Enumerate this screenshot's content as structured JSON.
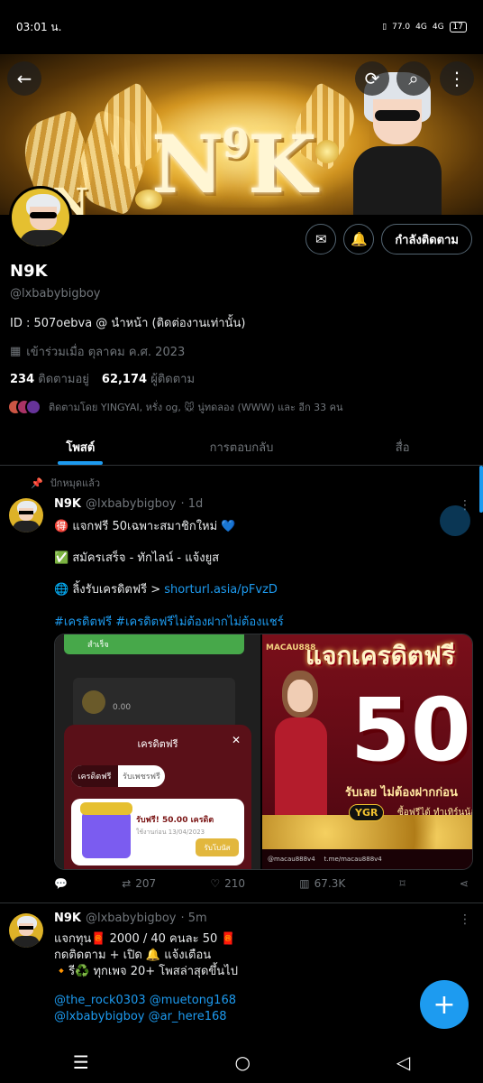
{
  "status_bar": {
    "time": "03:01 น.",
    "net_speed": "77.0",
    "signal1": "4G",
    "signal2": "4G",
    "battery": "17"
  },
  "banner": {
    "logo_main": "N",
    "logo_sup": "9",
    "logo_end": "K",
    "logo_small": "N"
  },
  "profile": {
    "name": "N9K",
    "handle": "@lxbabybigboy",
    "bio": "ID : 507oebva @ นำหน้า (ติดต่องานเท่านั้น)",
    "joined": "เข้าร่วมเมื่อ ตุลาคม ค.ศ. 2023",
    "following_count": "234",
    "following_label": "ติดตามอยู่",
    "followers_count": "62,174",
    "followers_label": "ผู้ติดตาม",
    "followed_by": "ติดตามโดย YINGYAI, หรั่ง og, 🐭 นู่ทดลอง (WWW) และ อีก 33 คน",
    "following_button": "กำลังติดตาม"
  },
  "tabs": [
    {
      "label": "โพสต์",
      "active": true
    },
    {
      "label": "การตอบกลับ",
      "active": false
    },
    {
      "label": "สื่อ",
      "active": false
    }
  ],
  "tweets": [
    {
      "pinned_label": "ปักหมุดแล้ว",
      "name": "N9K",
      "handle": "@lxbabybigboy",
      "time": "· 1d",
      "lines": [
        "🉐 แจกฟรี 50เฉพาะสมาชิกใหม่ 💙",
        "✅ สมัครเสร็จ - ทักไลน์ - แจ้งยูส",
        "🌐 ลิ้งรับเครดิตฟรี > "
      ],
      "link": "shorturl.asia/pFvzD",
      "hashtags": "#เครดิตฟรี #เครดิตฟรีไม่ต้องฝากไม่ต้องแชร์",
      "media_left": {
        "green_text": "สำเร็จ",
        "modal_title": "เครดิตฟรี",
        "tab_on": "เครดิตฟรี",
        "tab_off": "รับเพชรฟรี",
        "reward_title": "รับฟรี! 50.00 เครดิต",
        "reward_date": "ใช้งานก่อน 13/04/2023",
        "reward_button": "รับโบนัส",
        "balance": "0.00"
      },
      "media_right": {
        "brand": "MACAU888",
        "headline": "แจกเครดิตฟรี",
        "amount": "50",
        "sub": "รับเลย ไม่ต้องฝากก่อน",
        "ygr": "YGR",
        "ygr_text": "ซื้อฟรีได้ ทำเทิร์นน้อย",
        "footer1": "@macau888v4",
        "footer2": "t.me/macau888v4"
      },
      "retweets": "207",
      "likes": "210",
      "views": "67.3K"
    },
    {
      "name": "N9K",
      "handle": "@lxbabybigboy",
      "time": "· 5m",
      "lines": [
        "แจกทุน🧧 2000 / 40 คนละ 50 🧧",
        "กดติดตาม + เปิด 🔔 แจ้งเตือน",
        "🔸รี♻️ ทุกเพจ 20+ โพสล่าสุดขึ้นไป"
      ],
      "mentions1": "@the_rock0303 @muetong168",
      "mentions2": "@lxbabybigboy @ar_here168"
    }
  ],
  "colors": {
    "accent": "#1d9bf0",
    "background": "#000000",
    "muted": "#71767b"
  },
  "icons": [
    "back-arrow-icon",
    "sync-icon",
    "search-icon",
    "more-vertical-icon",
    "mail-icon",
    "bell-icon",
    "pin-icon",
    "reply-icon",
    "retweet-icon",
    "heart-icon",
    "views-icon",
    "bookmark-icon",
    "share-icon",
    "plus-icon",
    "calendar-icon"
  ]
}
